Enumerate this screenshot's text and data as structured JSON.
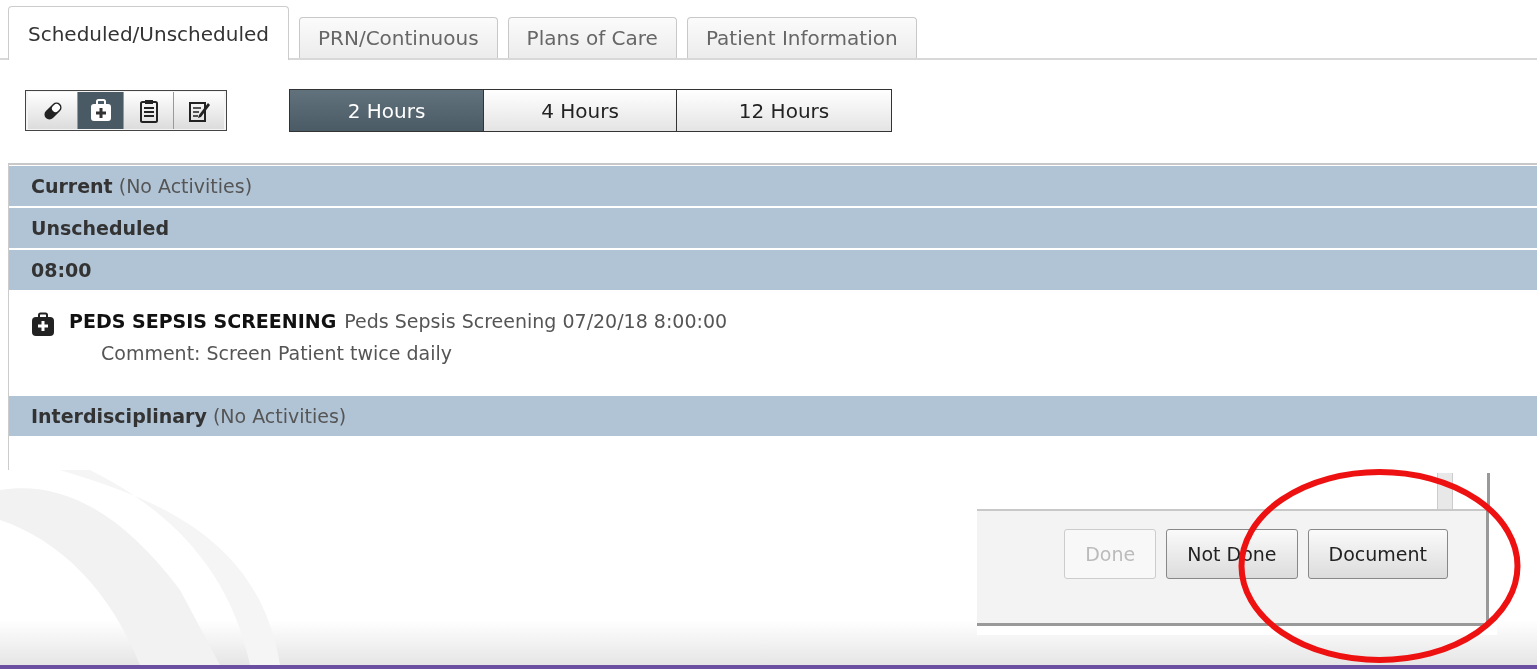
{
  "tabs": [
    {
      "label": "Scheduled/Unscheduled",
      "selected": true
    },
    {
      "label": "PRN/Continuous",
      "selected": false
    },
    {
      "label": "Plans of Care",
      "selected": false
    },
    {
      "label": "Patient Information",
      "selected": false
    }
  ],
  "view_icons": [
    {
      "kind": "pill",
      "selected": false
    },
    {
      "kind": "kit",
      "selected": true
    },
    {
      "kind": "clipboard",
      "selected": false
    },
    {
      "kind": "note",
      "selected": false
    }
  ],
  "time_ranges": [
    {
      "label": "2 Hours",
      "selected": true
    },
    {
      "label": "4 Hours",
      "selected": false
    },
    {
      "label": "12 Hours",
      "selected": false
    }
  ],
  "sections": [
    {
      "title": "Current",
      "note": "(No Activities)"
    },
    {
      "title": "Unscheduled"
    },
    {
      "title": "08:00",
      "activities": [
        {
          "name": "PEDS SEPSIS SCREENING",
          "detail": "Peds Sepsis Screening 07/20/18 8:00:00",
          "comment": "Comment: Screen Patient twice daily"
        }
      ]
    },
    {
      "title": "Interdisciplinary",
      "note": "(No Activities)"
    }
  ],
  "action_buttons": [
    {
      "label": "Done",
      "disabled": true
    },
    {
      "label": "Not Done",
      "disabled": false
    },
    {
      "label": "Document",
      "disabled": false
    }
  ]
}
